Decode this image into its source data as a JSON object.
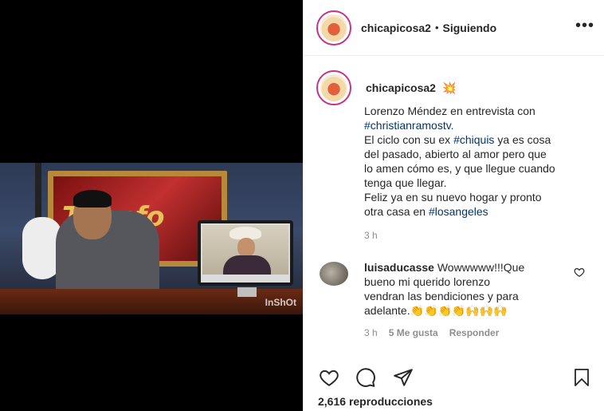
{
  "post": {
    "username": "chicapicosa2",
    "separator": "•",
    "follow_status": "Siguiendo",
    "more_label": "•••",
    "caption_emoji": "💥",
    "caption": {
      "l1": "Lorenzo Méndez en entrevista con",
      "l2_tag": "#christianramostv",
      "l2_end": ".",
      "l3_pre": "El ciclo con su ex ",
      "l3_tag": "#chiquis",
      "l3_post": " ya es cosa",
      "l4": "del pasado, abierto al amor pero que",
      "l5": "lo amen cómo es, y que llegue cuando",
      "l6": "tenga que llegar.",
      "l7": "Feliz ya en su nuevo hogar y pronto",
      "l8_pre": "otra casa en ",
      "l8_tag": "#losangeles"
    },
    "caption_time": "3 h",
    "video_watermark": "InShOt",
    "video_frame_text": "Triunfo"
  },
  "comment": {
    "username": "luisaducasse",
    "text_l1": "Wowwwww!!!Que",
    "text_l2": "bueno mi querido lorenzo",
    "text_l3": "vendran las bendiciones y para",
    "text_l4": "adelante.👏👏👏👏🙌🙌🙌",
    "time": "3 h",
    "likes": "5 Me gusta",
    "reply": "Responder"
  },
  "stats": {
    "views_count": "2,616",
    "views_label": "reproducciones"
  }
}
